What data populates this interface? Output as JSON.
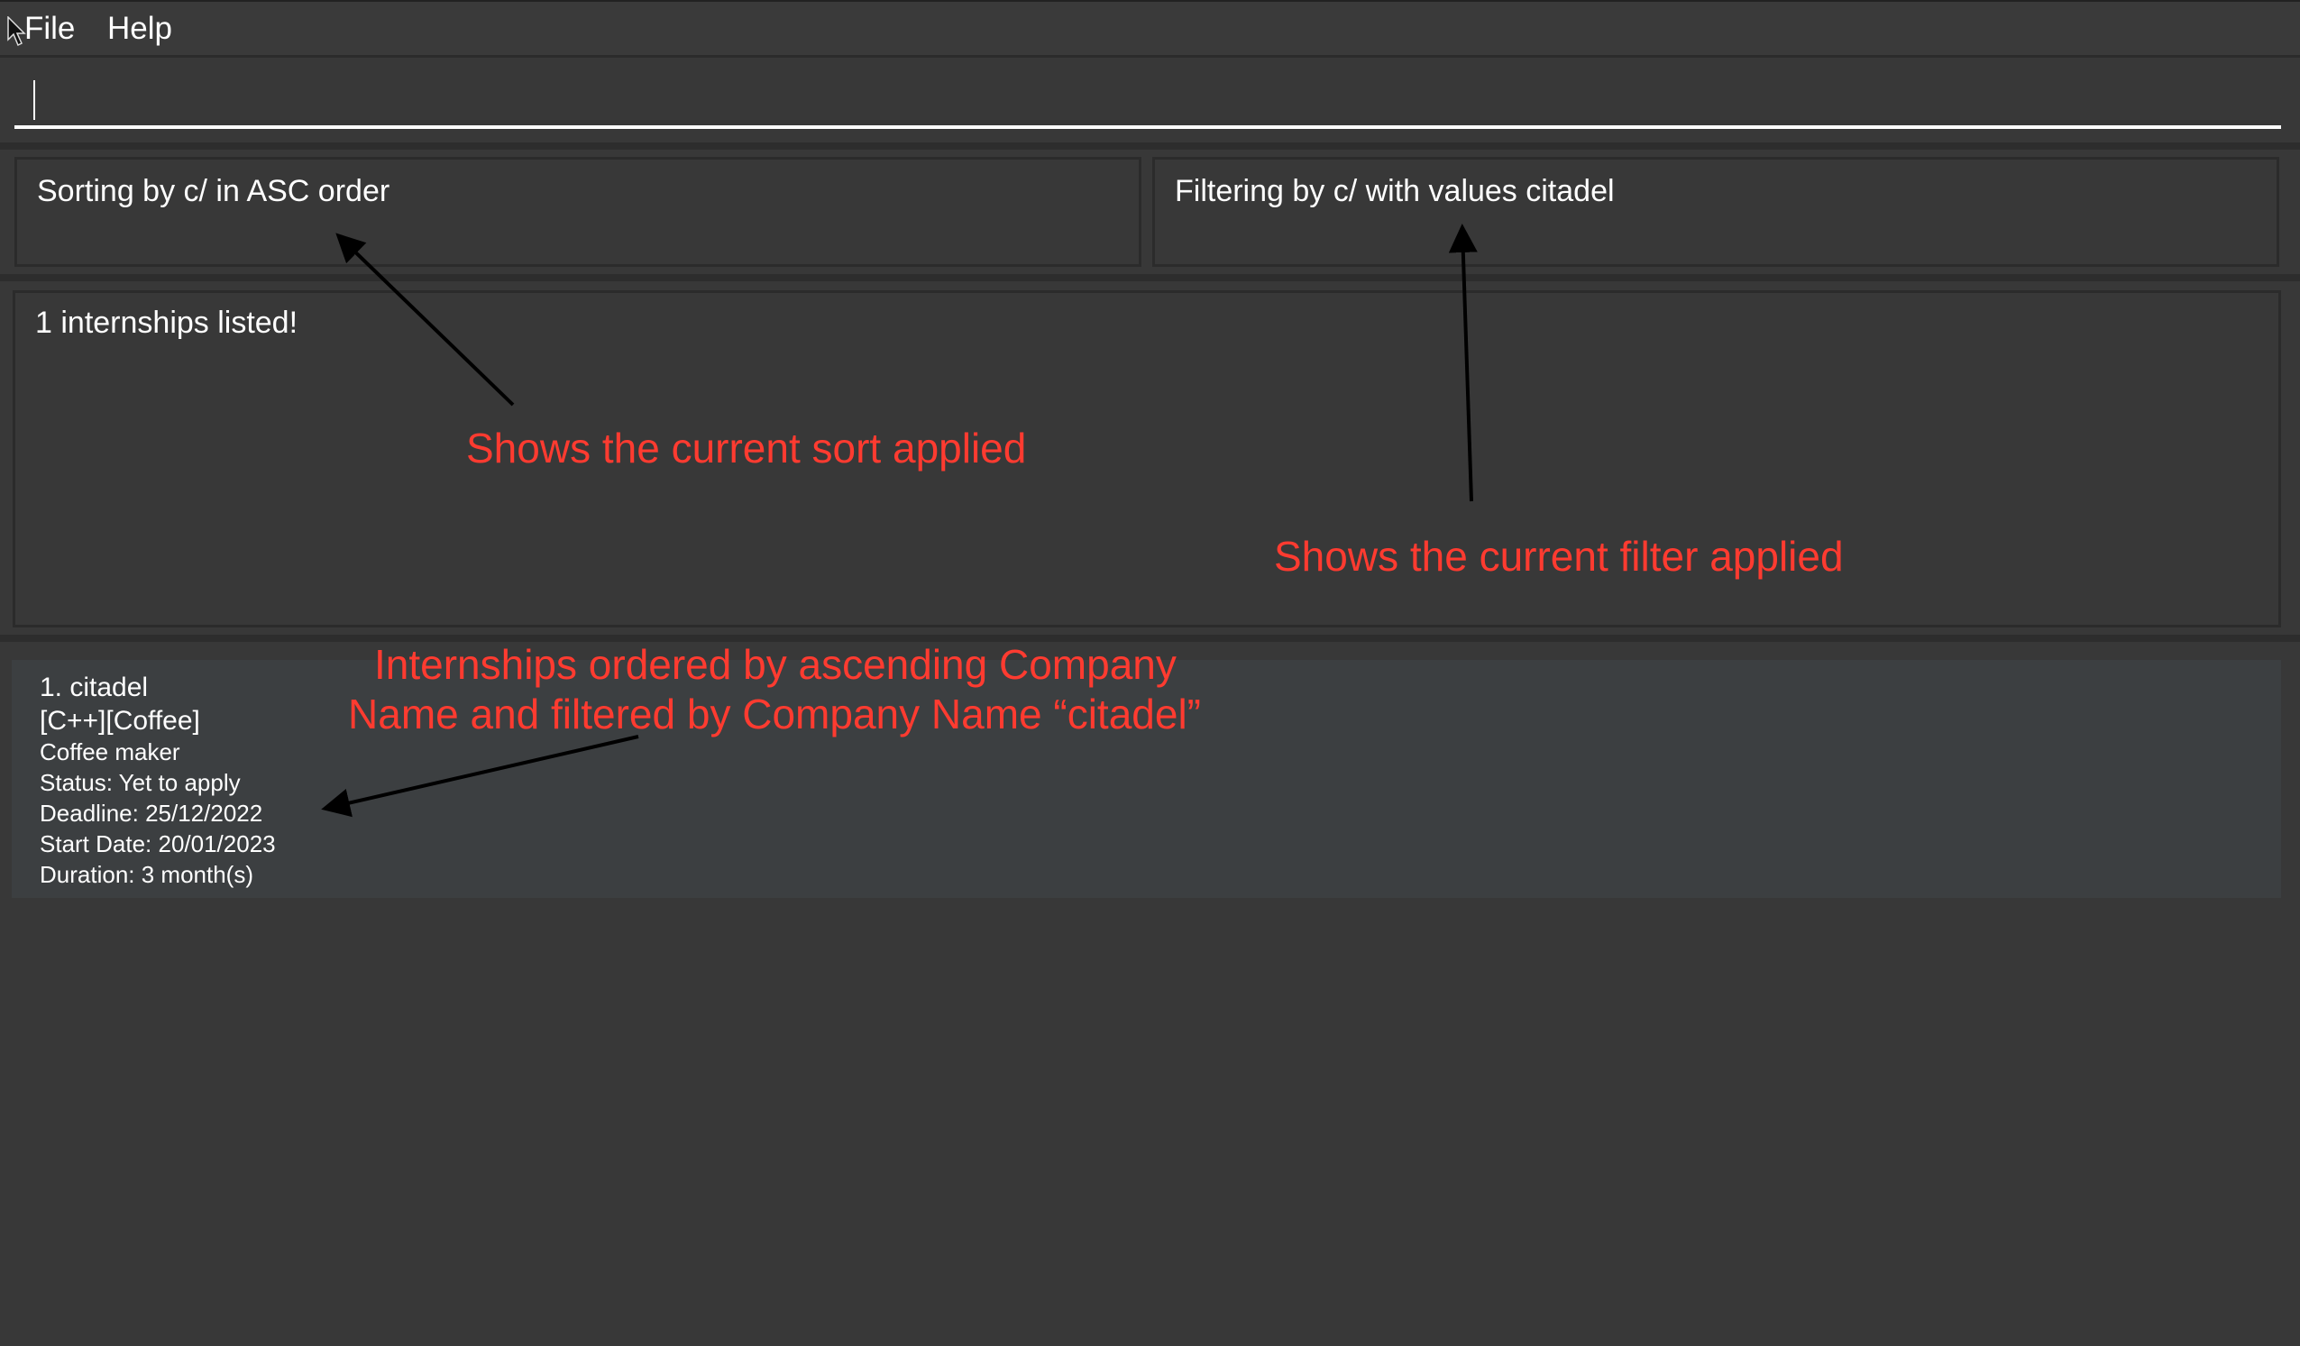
{
  "menu": {
    "file": "File",
    "help": "Help"
  },
  "command_box": {
    "value": "",
    "placeholder": ""
  },
  "sort_panel": {
    "text": "Sorting by c/ in ASC order"
  },
  "filter_panel": {
    "text": "Filtering by c/ with values citadel"
  },
  "result_display": {
    "text": "1 internships listed!"
  },
  "internships": [
    {
      "index_name": "1.  citadel",
      "tags": "[C++][Coffee]",
      "role": "Coffee maker",
      "status": "Status: Yet to apply",
      "deadline": "Deadline: 25/12/2022",
      "start_date": "Start Date: 20/01/2023",
      "duration": "Duration: 3 month(s)"
    }
  ],
  "annotations": {
    "sort": "Shows the current sort applied",
    "filter": "Shows the current filter applied",
    "list_line1": "Internships ordered by ascending Company",
    "list_line2": "Name and filtered by Company Name “citadel”"
  },
  "colors": {
    "annotation": "#ff3b30",
    "background": "#383838",
    "card": "#3c3f41"
  }
}
